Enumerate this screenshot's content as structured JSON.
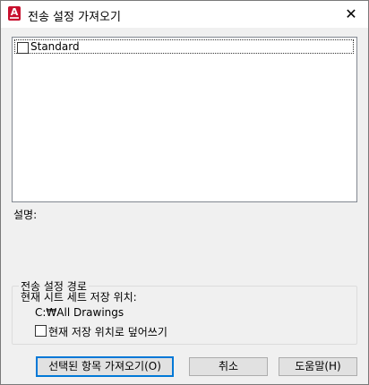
{
  "window": {
    "title": "전송 설정 가져오기",
    "app_icon_letter": "A",
    "close_symbol": "✕"
  },
  "list": {
    "items": [
      {
        "label": "Standard",
        "checked": false
      }
    ]
  },
  "description": {
    "label": "설명:"
  },
  "path_group": {
    "title": "전송 설정 경로",
    "current_location_label": "현재 시트 세트 저장 위치:",
    "current_location_value": "C:₩All Drawings",
    "overwrite_label": "현재 저장 위치로 덮어쓰기",
    "overwrite_checked": false
  },
  "buttons": {
    "import_selected": "선택된 항목 가져오기(O)",
    "cancel": "취소",
    "help": "도움말(H)"
  },
  "colors": {
    "app_icon": "#c8102e",
    "default_button_border": "#0078d7"
  }
}
